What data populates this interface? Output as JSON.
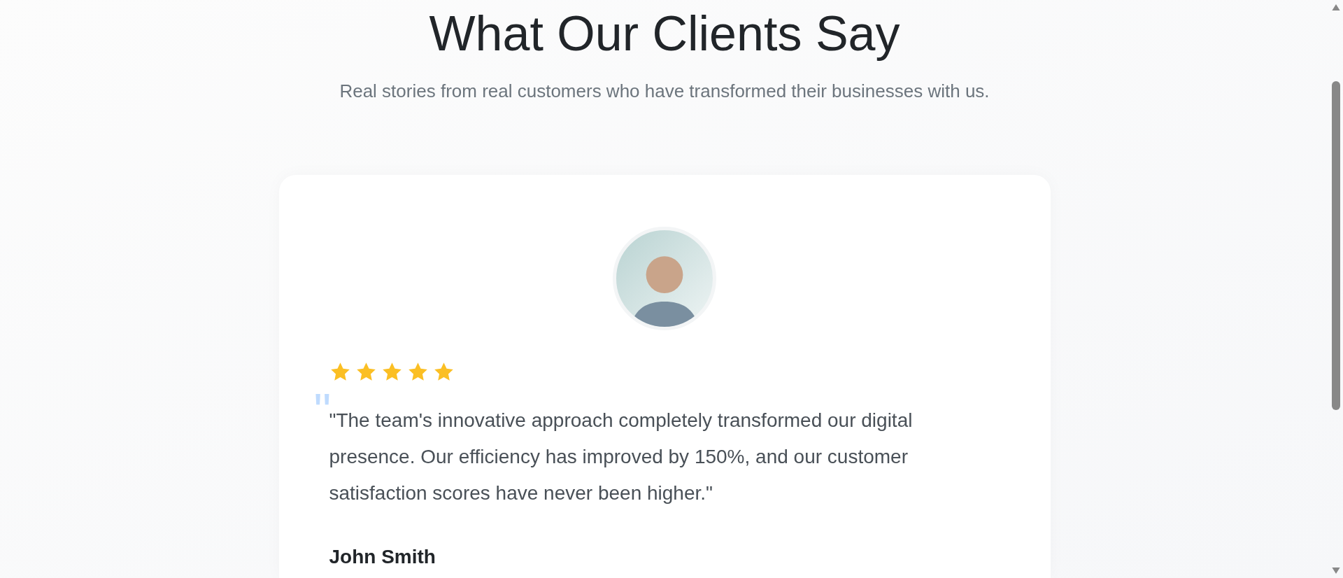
{
  "heading": "What Our Clients Say",
  "subheading": "Real stories from real customers who have transformed their businesses with us.",
  "testimonial": {
    "stars": 5,
    "quote_mark": "\"",
    "quote": "\"The team's innovative approach completely transformed our digital presence. Our efficiency has improved by 150%, and our customer satisfaction scores have never been higher.\"",
    "name": "John Smith"
  }
}
